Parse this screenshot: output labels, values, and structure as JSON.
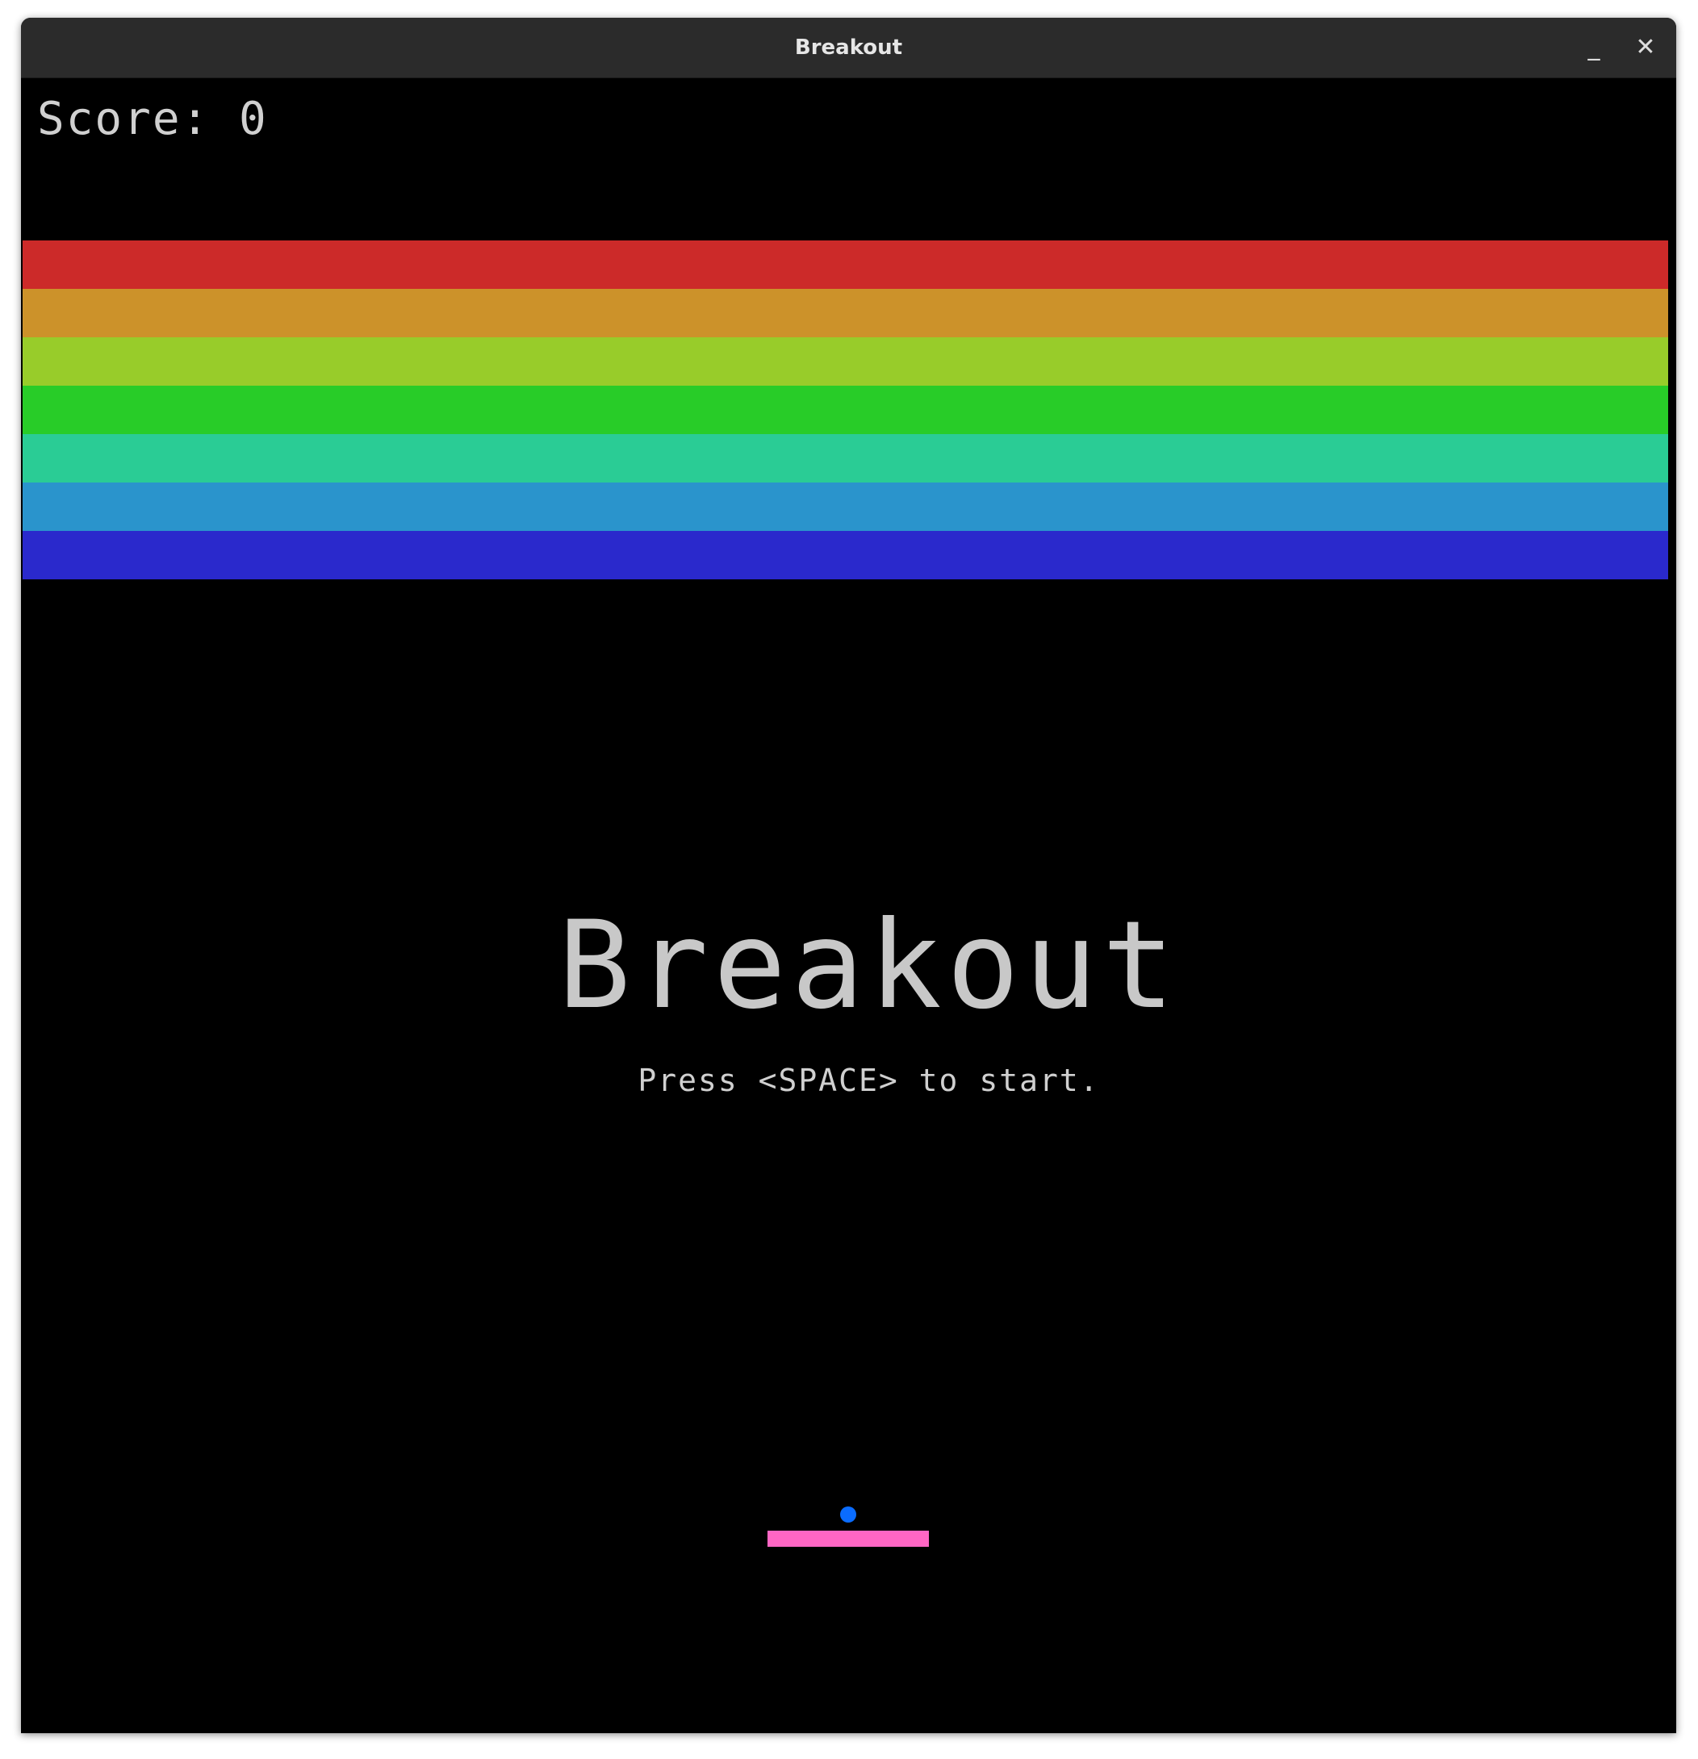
{
  "window": {
    "title": "Breakout",
    "minimize_label": "_",
    "close_label": "✕"
  },
  "game": {
    "score_text": "Score: 0",
    "score": 0,
    "headline": "Breakout",
    "prompt": "Press <SPACE> to start.",
    "brick_rows": [
      {
        "color": "#cc2a29"
      },
      {
        "color": "#cc922a"
      },
      {
        "color": "#98cc2a"
      },
      {
        "color": "#28cc28"
      },
      {
        "color": "#2acc95"
      },
      {
        "color": "#2a94cc"
      },
      {
        "color": "#2a29cc"
      }
    ],
    "ball_color": "#0a6cff",
    "paddle_color": "#ff66c4"
  }
}
